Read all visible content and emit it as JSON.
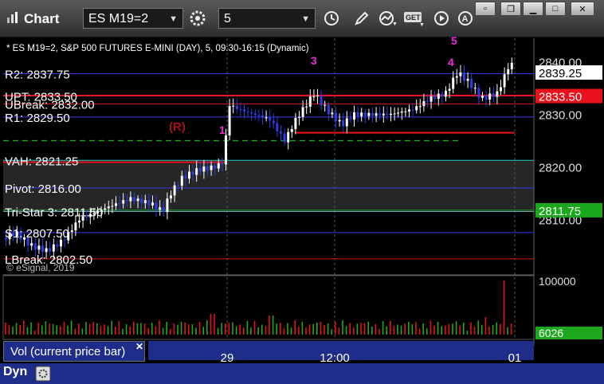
{
  "window": {
    "title": "Chart"
  },
  "toolbar": {
    "symbol": "ES M19=2",
    "interval": "5"
  },
  "chart_data": {
    "type": "candlestick",
    "title": "* ES M19=2, S&P 500 FUTURES E-MINI (DAY), 5, 09:30-16:15 (Dynamic)",
    "copyright": "© eSignal, 2019",
    "y_ticks": [
      "2840.00",
      "2830.00",
      "2820.00",
      "2810.00"
    ],
    "y_tick_values": [
      2840,
      2830,
      2820,
      2810
    ],
    "ylim": [
      2799.6,
      2844.5
    ],
    "x_ticks": [
      "29",
      "12:00",
      "01"
    ],
    "last_price": "2839.25",
    "price_tags": [
      {
        "label": "2833.50",
        "value": 2833.5,
        "color": "#e8101a",
        "text_color": "#ffffff"
      },
      {
        "label": "2811.75",
        "value": 2811.75,
        "color": "#19a81b",
        "text_color": "#ffffff"
      }
    ],
    "levels": [
      {
        "label": "R2: 2837.75",
        "value": 2837.75,
        "color": "#3a3ae8"
      },
      {
        "label": "UPT: 2833.50",
        "value": 2833.5,
        "color": "#6fa0c8"
      },
      {
        "label": "UBreak: 2832.00",
        "value": 2832.0,
        "color": "#d41c1c"
      },
      {
        "label": "R1: 2829.50",
        "value": 2829.5,
        "color": "#3a3ae8"
      },
      {
        "label": "VAH: 2821.25",
        "value": 2821.25,
        "color": "#28c8c8"
      },
      {
        "label": "Pivot: 2816.00",
        "value": 2816.0,
        "color": "#3a3ae8"
      },
      {
        "label": "Tri-Star 3: 2811.50",
        "value": 2811.5,
        "color": "#6fa0c8"
      },
      {
        "label": "S1: 2807.50",
        "value": 2807.5,
        "color": "#3a3ae8"
      },
      {
        "label": "LBreak: 2802.50",
        "value": 2802.5,
        "color": "#d41c1c"
      }
    ],
    "dashed_level": {
      "value": 2825.0,
      "color": "#19a81b"
    },
    "red_segment": {
      "value": 2826.5,
      "color": "#e8101a"
    },
    "wave_labels": [
      {
        "text": "(R)",
        "color": "#a8101a"
      },
      {
        "text": "1",
        "color": "#f028e0"
      },
      {
        "text": "3",
        "color": "#f028e0"
      },
      {
        "text": "4",
        "color": "#f028e0"
      },
      {
        "text": "5",
        "color": "#f028e0"
      }
    ],
    "volume": {
      "label": "Vol (current price bar)",
      "y_ticks": [
        "100000"
      ],
      "current": "6026",
      "max": 100000
    },
    "bottom_label": "Dyn"
  }
}
